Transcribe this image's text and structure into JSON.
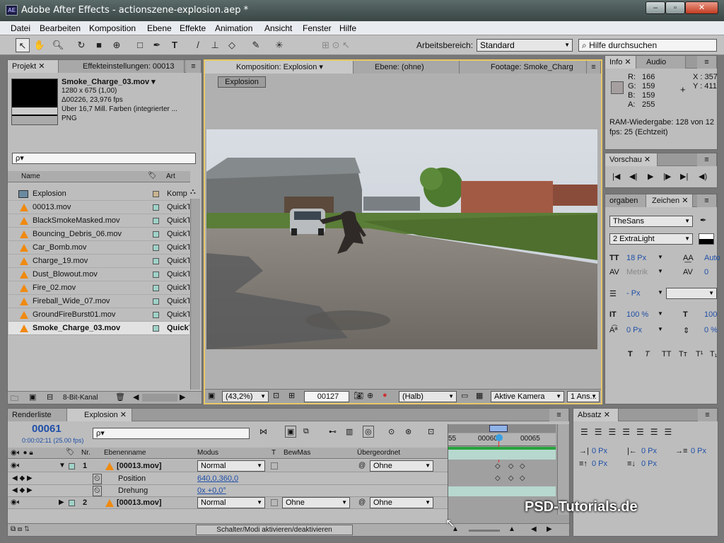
{
  "window": {
    "title": "Adobe After Effects - actionszene-explosion.aep *",
    "app_icon": "AE",
    "controls": [
      "–",
      "▫",
      "✕"
    ]
  },
  "menu": [
    "Datei",
    "Bearbeiten",
    "Komposition",
    "Ebene",
    "Effekte",
    "Animation",
    "Ansicht",
    "Fenster",
    "Hilfe"
  ],
  "toolbar": {
    "workspace_label": "Arbeitsbereich:",
    "workspace_value": "Standard",
    "search_placeholder": "Hilfe durchsuchen"
  },
  "project_panel": {
    "tabs": [
      "Projekt",
      "Effekteinstellungen: 00013"
    ],
    "selected_item": {
      "name": "Smoke_Charge_03.mov ▾",
      "info": [
        "1280 x 675 (1,00)",
        "Δ00226, 23,976 fps",
        "Über 16,7 Mill. Farben (integrierter ...",
        "PNG"
      ]
    },
    "search_placeholder": "ρ▾",
    "columns": {
      "name": "Name",
      "type": "Art"
    },
    "items": [
      {
        "name": "Explosion",
        "type": "Komp",
        "kind": "comp"
      },
      {
        "name": "00013.mov",
        "type": "QuickT",
        "kind": "footage"
      },
      {
        "name": "BlackSmokeMasked.mov",
        "type": "QuickT",
        "kind": "footage"
      },
      {
        "name": "Bouncing_Debris_06.mov",
        "type": "QuickT",
        "kind": "footage"
      },
      {
        "name": "Car_Bomb.mov",
        "type": "QuickT",
        "kind": "footage"
      },
      {
        "name": "Charge_19.mov",
        "type": "QuickT",
        "kind": "footage"
      },
      {
        "name": "Dust_Blowout.mov",
        "type": "QuickT",
        "kind": "footage"
      },
      {
        "name": "Fire_02.mov",
        "type": "QuickT",
        "kind": "footage"
      },
      {
        "name": "Fireball_Wide_07.mov",
        "type": "QuickT",
        "kind": "footage"
      },
      {
        "name": "GroundFireBurst01.mov",
        "type": "QuickT",
        "kind": "footage"
      },
      {
        "name": "Smoke_Charge_03.mov",
        "type": "QuickT",
        "kind": "footage",
        "selected": true
      }
    ],
    "bit_depth": "8-Bit-Kanal"
  },
  "comp_panel": {
    "tabs": [
      "Komposition: Explosion",
      "Ebene: (ohne)",
      "Footage: Smoke_Charg"
    ],
    "comp_button": "Explosion",
    "zoom": "(43,2%)",
    "frame": "00127",
    "resolution": "(Halb)",
    "camera": "Aktive Kamera",
    "views": "1 Ans..."
  },
  "info_panel": {
    "tabs": [
      "Info",
      "Audio"
    ],
    "rgba": [
      {
        "k": "R:",
        "v": "166"
      },
      {
        "k": "G:",
        "v": "159"
      },
      {
        "k": "B:",
        "v": "159"
      },
      {
        "k": "A:",
        "v": "255"
      }
    ],
    "x": "X : 357",
    "y": "Y : 411",
    "ram_line1": "RAM-Wiedergabe: 128 von 12",
    "ram_line2": "fps: 25 (Echtzeit)"
  },
  "preview_panel": {
    "tab": "Vorschau",
    "buttons": [
      "|◀",
      "◀|",
      "▶",
      "|▶",
      "▶|",
      "◀)"
    ]
  },
  "char_panel": {
    "tabs": [
      "orgaben",
      "Zeichen"
    ],
    "font": "TheSans",
    "style": "2 ExtraLight",
    "size": "18 Px",
    "leading": "Auto",
    "kerning": "Metrik",
    "tracking": "0",
    "stroke": "- Px",
    "vscale": "100 %",
    "hscale": "100",
    "baseline": "0 Px",
    "tsume": "0 %",
    "styles": [
      "T",
      "T",
      "TT",
      "Tт",
      "T¹",
      "T₁"
    ]
  },
  "timeline": {
    "tabs": [
      "Renderliste",
      "Explosion"
    ],
    "timecode": "00061",
    "timecode_sub": "0:00:02:11 (25.00 fps)",
    "search_placeholder": "ρ▾",
    "columns": {
      "nr": "Nr.",
      "name": "Ebenenname",
      "mode": "Modus",
      "t": "T",
      "trkmat": "BewMas",
      "parent": "Übergeordnet"
    },
    "layers": [
      {
        "nr": "1",
        "name": "[00013.mov]",
        "mode": "Normal",
        "trkmat": "",
        "parent": "Ohne"
      },
      {
        "nr": "2",
        "name": "[00013.mov]",
        "mode": "Normal",
        "trkmat": "Ohne",
        "parent": "Ohne"
      }
    ],
    "props": [
      {
        "name": "Position",
        "value": "640,0,360,0"
      },
      {
        "name": "Drehung",
        "value": "0x +0,0°"
      }
    ],
    "ruler": [
      "55",
      "00060",
      "00065"
    ],
    "toggle_button": "Schalter/Modi aktivieren/deaktivieren"
  },
  "paragraph_panel": {
    "tab": "Absatz",
    "values": [
      "0 Px",
      "0 Px",
      "0 Px",
      "0 Px",
      "0 Px"
    ]
  },
  "watermark": "PSD-Tutorials.de"
}
